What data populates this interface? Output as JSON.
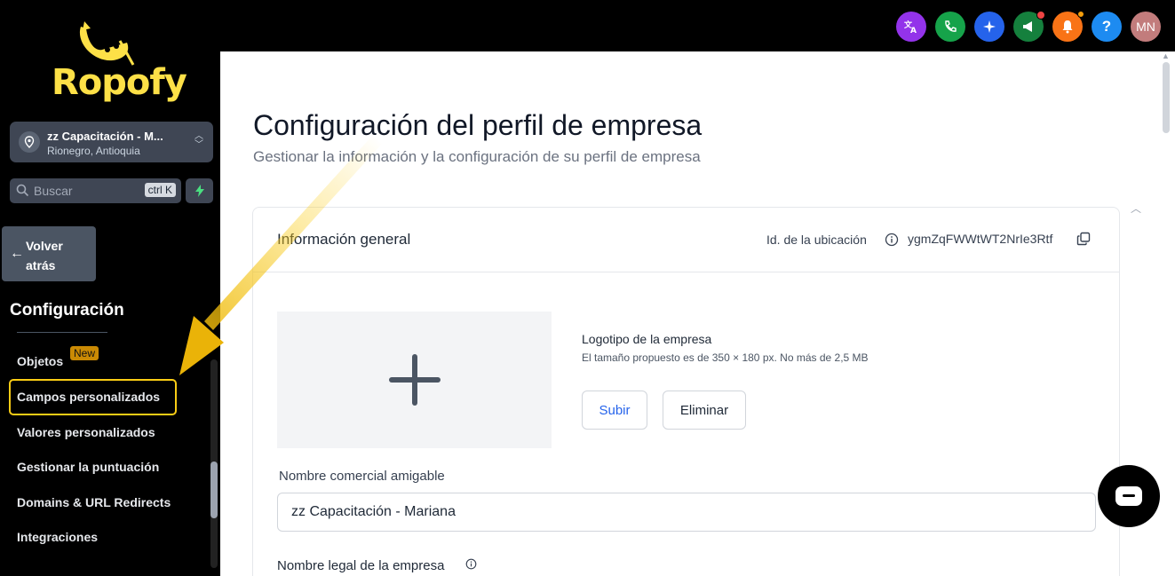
{
  "brand": {
    "name": "Ropofy"
  },
  "location": {
    "name": "zz Capacitación - M...",
    "city": "Rionegro, Antioquia"
  },
  "search": {
    "placeholder": "Buscar",
    "shortcut": "ctrl K"
  },
  "sidebar": {
    "back_label": "Volver atrás",
    "section_title": "Configuración",
    "items": [
      {
        "label": "Objetos",
        "badge": "New"
      },
      {
        "label": "Campos personalizados"
      },
      {
        "label": "Valores personalizados"
      },
      {
        "label": "Gestionar la puntuación"
      },
      {
        "label": "Domains & URL Redirects"
      },
      {
        "label": "Integraciones"
      }
    ]
  },
  "topbar": {
    "icons": [
      {
        "name": "translate-icon",
        "color": "#9333ea"
      },
      {
        "name": "phone-icon",
        "color": "#16a34a"
      },
      {
        "name": "sparkle-icon",
        "color": "#2563eb"
      },
      {
        "name": "megaphone-icon",
        "color": "#15803d"
      },
      {
        "name": "bell-icon",
        "color": "#f97316"
      },
      {
        "name": "help-icon",
        "color": "#1d8bf1",
        "text": "?"
      }
    ],
    "avatar_initials": "MN",
    "avatar_color": "#c27c7c"
  },
  "page": {
    "title": "Configuración del perfil de empresa",
    "subtitle": "Gestionar la información y la configuración de su perfil de empresa"
  },
  "general": {
    "title": "Información general",
    "location_id_label": "Id. de la ubicación",
    "location_id": "ygmZqFWWtWT2NrIe3Rtf",
    "logo_label": "Logotipo de la empresa",
    "logo_hint": "El tamaño propuesto es de 350 × 180 px. No más de 2,5 MB",
    "upload_label": "Subir",
    "delete_label": "Eliminar",
    "friendly_name_label": "Nombre comercial amigable",
    "friendly_name_value": "zz Capacitación - Mariana",
    "legal_name_label": "Nombre legal de la empresa"
  },
  "colors": {
    "accent": "#facc15",
    "sidebar_bg": "#000000"
  }
}
